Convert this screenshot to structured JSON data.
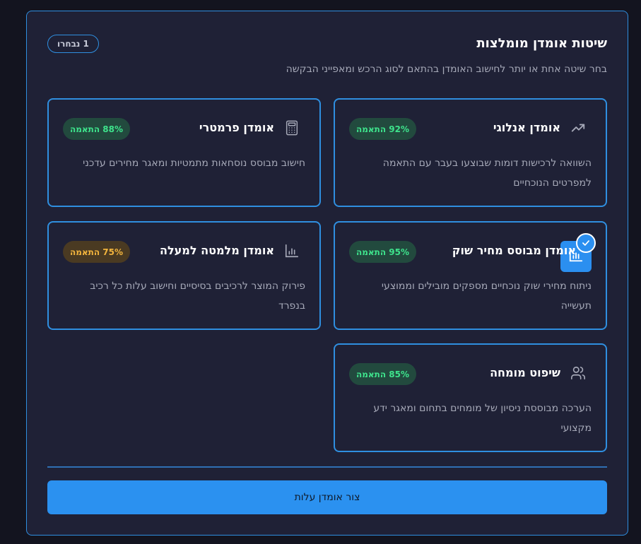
{
  "header": {
    "title": "שיטות אומדן מומלצות",
    "subtitle": "בחר שיטה אחת או יותר לחישוב האומדן בהתאם לסוג הרכש ומאפייני הבקשה",
    "selected_count": "1 נבחרו"
  },
  "methods": [
    {
      "title": "אומדן אנלוגי",
      "match": "92% התאמה",
      "match_value": 92,
      "description": "השוואה לרכישות דומות שבוצעו בעבר עם התאמה למפרטים הנוכחיים",
      "icon": "trending-up-icon",
      "selected": false
    },
    {
      "title": "אומדן פרמטרי",
      "match": "88% התאמה",
      "match_value": 88,
      "description": "חישוב מבוסס נוסחאות מתמטיות ומאגר מחירים עדכני",
      "icon": "calculator-icon",
      "selected": false
    },
    {
      "title": "אומדן מבוסס מחיר שוק",
      "match": "95% התאמה",
      "match_value": 95,
      "description": "ניתוח מחירי שוק נוכחיים מספקים מובילים וממוצעי תעשייה",
      "icon": "bar-chart-icon",
      "selected": true
    },
    {
      "title": "אומדן מלמטה למעלה",
      "match": "75% התאמה",
      "match_value": 75,
      "description": "פירוק המוצר לרכיבים בסיסיים וחישוב עלות כל רכיב בנפרד",
      "icon": "bar-chart-icon",
      "selected": false
    },
    {
      "title": "שיפוט מומחה",
      "match": "85% התאמה",
      "match_value": 85,
      "description": "הערכה מבוססת ניסיון של מומחים בתחום ומאגר ידע מקצועי",
      "icon": "users-icon",
      "selected": false
    }
  ],
  "colors": {
    "accent": "#2b91f0",
    "match_high": "#3ee38c",
    "match_medium": "#f2b43d",
    "background": "#1f2136"
  },
  "cta": {
    "label": "צור אומדן עלות"
  }
}
